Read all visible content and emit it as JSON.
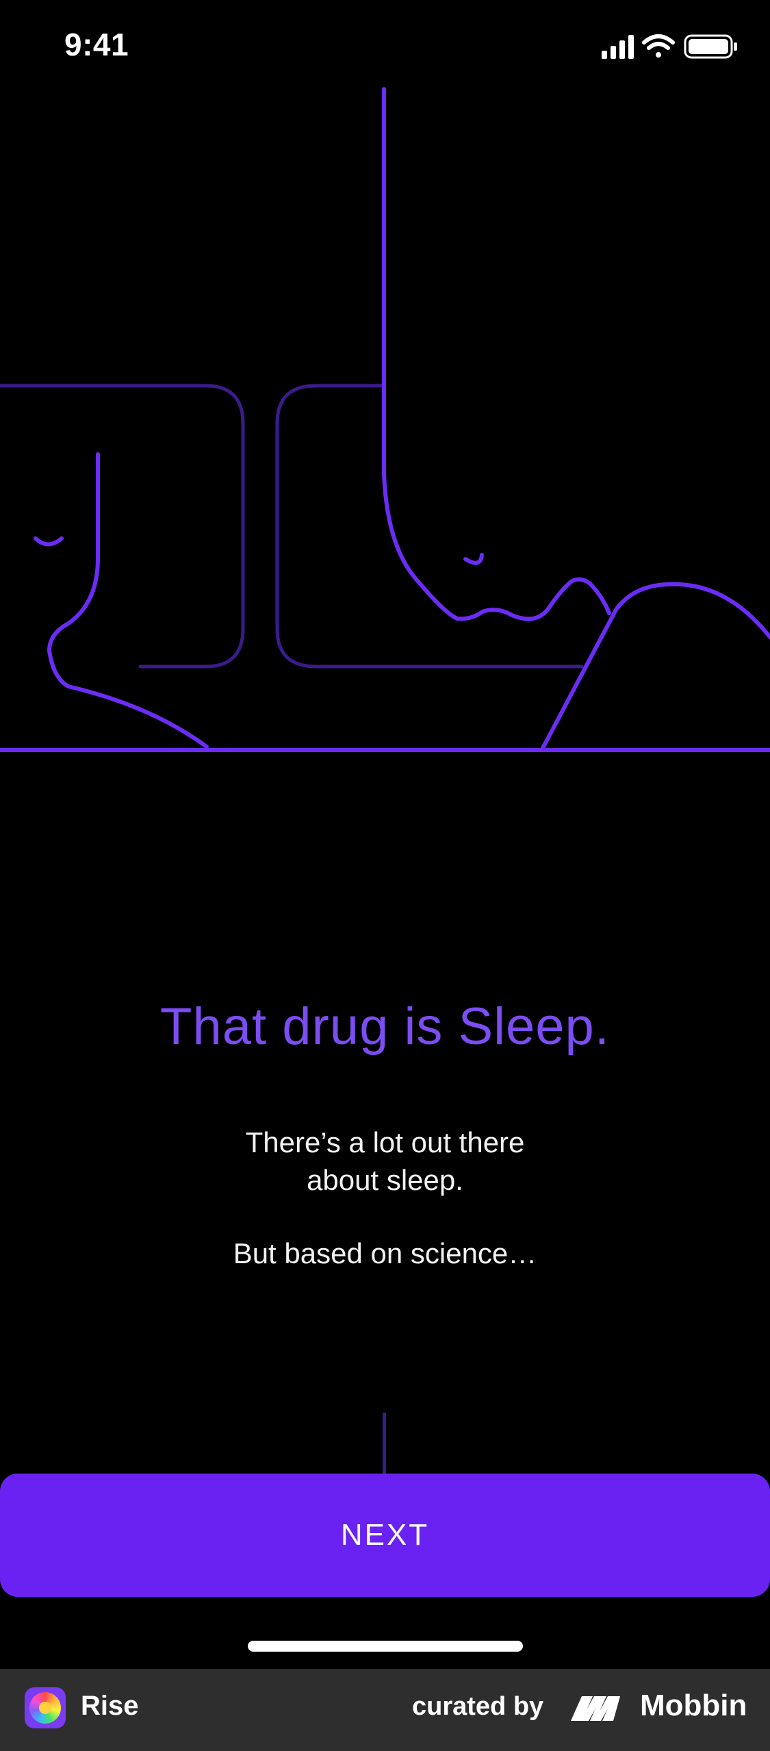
{
  "status_bar": {
    "time": "9:41"
  },
  "content": {
    "headline": "That drug is Sleep.",
    "body_line1": "There’s a lot out there",
    "body_line2": "about sleep.",
    "body_line3": "But based on science…"
  },
  "actions": {
    "next_label": "NEXT"
  },
  "footer": {
    "app_name": "Rise",
    "curated_by": "curated by",
    "brand": "Mobbin"
  },
  "colors": {
    "accent": "#6A22F2",
    "headline": "#7B4DF2",
    "line_bright": "#6B2CF5",
    "line_dim": "#3A1C8C",
    "background": "#000000",
    "footer_bg": "#2E2E2E"
  },
  "icons": [
    "signal-icon",
    "wifi-icon",
    "battery-icon",
    "rise-app-icon",
    "mobbin-logo-icon"
  ]
}
